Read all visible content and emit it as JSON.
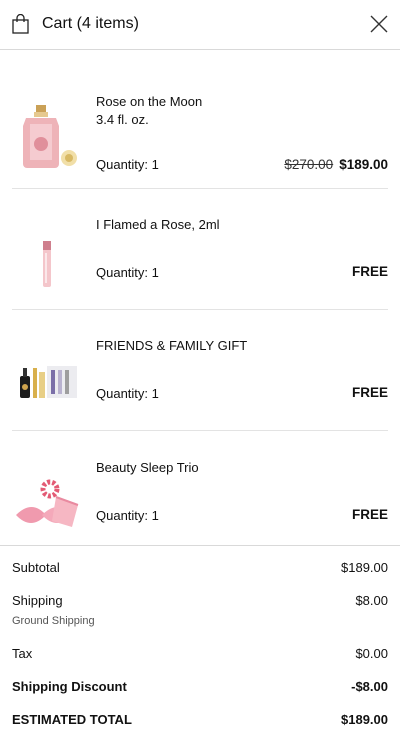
{
  "header": {
    "title": "Cart (4 items)"
  },
  "items": [
    {
      "name": "Rose on the Moon",
      "size": "3.4 fl. oz.",
      "quantity": "Quantity: 1",
      "old_price": "$270.00",
      "price": "$189.00"
    },
    {
      "name": "I Flamed a Rose, 2ml",
      "quantity": "Quantity: 1",
      "price": "FREE"
    },
    {
      "name": "FRIENDS & FAMILY GIFT",
      "quantity": "Quantity: 1",
      "price": "FREE"
    },
    {
      "name": "Beauty Sleep Trio",
      "quantity": "Quantity: 1",
      "price": "FREE"
    }
  ],
  "summary": {
    "subtotal_label": "Subtotal",
    "subtotal": "$189.00",
    "shipping_label": "Shipping",
    "shipping": "$8.00",
    "shipping_method": "Ground Shipping",
    "tax_label": "Tax",
    "tax": "$0.00",
    "discount_label": "Shipping Discount",
    "discount": "-$8.00",
    "total_label": "ESTIMATED TOTAL",
    "total": "$189.00"
  }
}
